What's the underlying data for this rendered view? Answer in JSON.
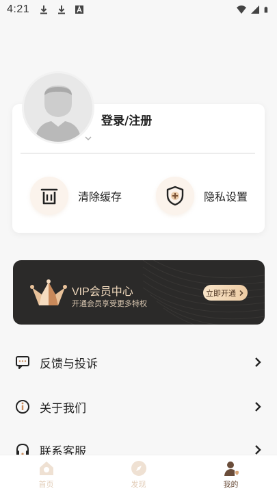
{
  "status_bar": {
    "time": "4:21"
  },
  "profile": {
    "login_label": "登录/注册"
  },
  "actions": {
    "clear_cache": "清除缓存",
    "privacy_settings": "隐私设置"
  },
  "vip": {
    "title": "VIP会员中心",
    "subtitle": "开通会员享受更多特权",
    "button_label": "立即开通"
  },
  "menu": {
    "items": [
      {
        "label": "反馈与投诉",
        "icon": "message-icon"
      },
      {
        "label": "关于我们",
        "icon": "info-icon"
      },
      {
        "label": "联系客服",
        "icon": "headset-icon"
      }
    ]
  },
  "bottom_nav": {
    "items": [
      {
        "label": "首页",
        "icon": "home-icon",
        "active": false
      },
      {
        "label": "发现",
        "icon": "compass-icon",
        "active": false
      },
      {
        "label": "我的",
        "icon": "profile-icon",
        "active": true
      }
    ]
  },
  "colors": {
    "accent": "#6a4d3a",
    "vip_gold": "#f0d9bd",
    "vip_bg": "#2b2a29"
  }
}
